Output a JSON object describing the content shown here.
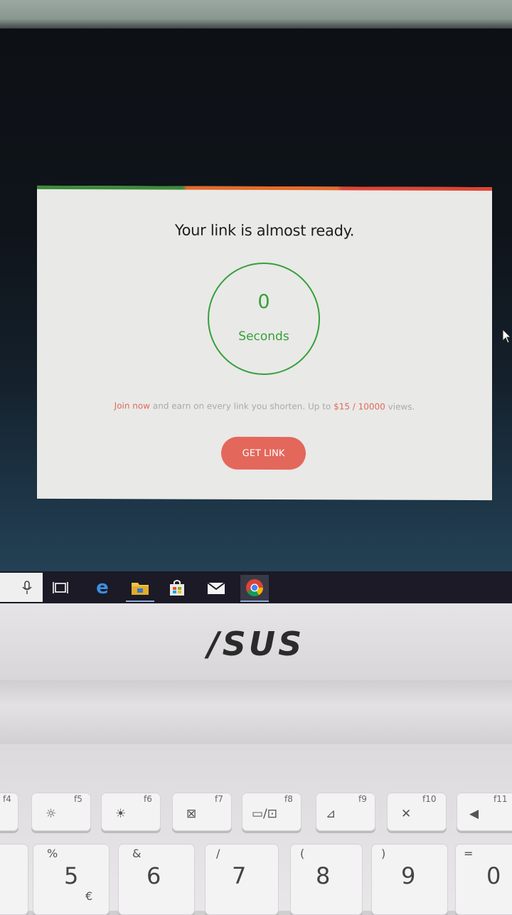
{
  "dialog": {
    "title": "Your link is almost ready.",
    "countdown_value": "0",
    "countdown_unit": "Seconds",
    "promo_link": "Join now",
    "promo_text_1": " and earn on every link you shorten. Up to ",
    "promo_rate": "$15 / 10000",
    "promo_text_2": " views.",
    "button_label": "GET LINK",
    "stripe_colors": [
      "#3d8a3a",
      "#e66a2a",
      "#e04433"
    ],
    "accent_color": "#e4675b",
    "timer_color": "#34a03a"
  },
  "taskbar": {
    "icons": [
      "microphone-icon",
      "task-view-icon",
      "edge-browser-icon",
      "file-explorer-icon",
      "store-icon",
      "mail-icon",
      "chrome-icon"
    ]
  },
  "laptop": {
    "brand": "/SUS"
  },
  "keyboard": {
    "function_keys": [
      {
        "label": "f4",
        "glyph": ""
      },
      {
        "label": "f5",
        "glyph": "☼"
      },
      {
        "label": "f6",
        "glyph": "☀"
      },
      {
        "label": "f7",
        "glyph": "⊠"
      },
      {
        "label": "f8",
        "glyph": "▭/⊡"
      },
      {
        "label": "f9",
        "glyph": "⊿"
      },
      {
        "label": "f10",
        "glyph": "✕"
      },
      {
        "label": "f11",
        "glyph": "◀"
      }
    ],
    "number_keys": [
      {
        "shift": "",
        "main": ""
      },
      {
        "shift": "%",
        "main": "5",
        "extra": "€"
      },
      {
        "shift": "&",
        "main": "6"
      },
      {
        "shift": "/",
        "main": "7"
      },
      {
        "shift": "(",
        "main": "8"
      },
      {
        "shift": ")",
        "main": "9"
      },
      {
        "shift": "=",
        "main": "0"
      }
    ]
  }
}
